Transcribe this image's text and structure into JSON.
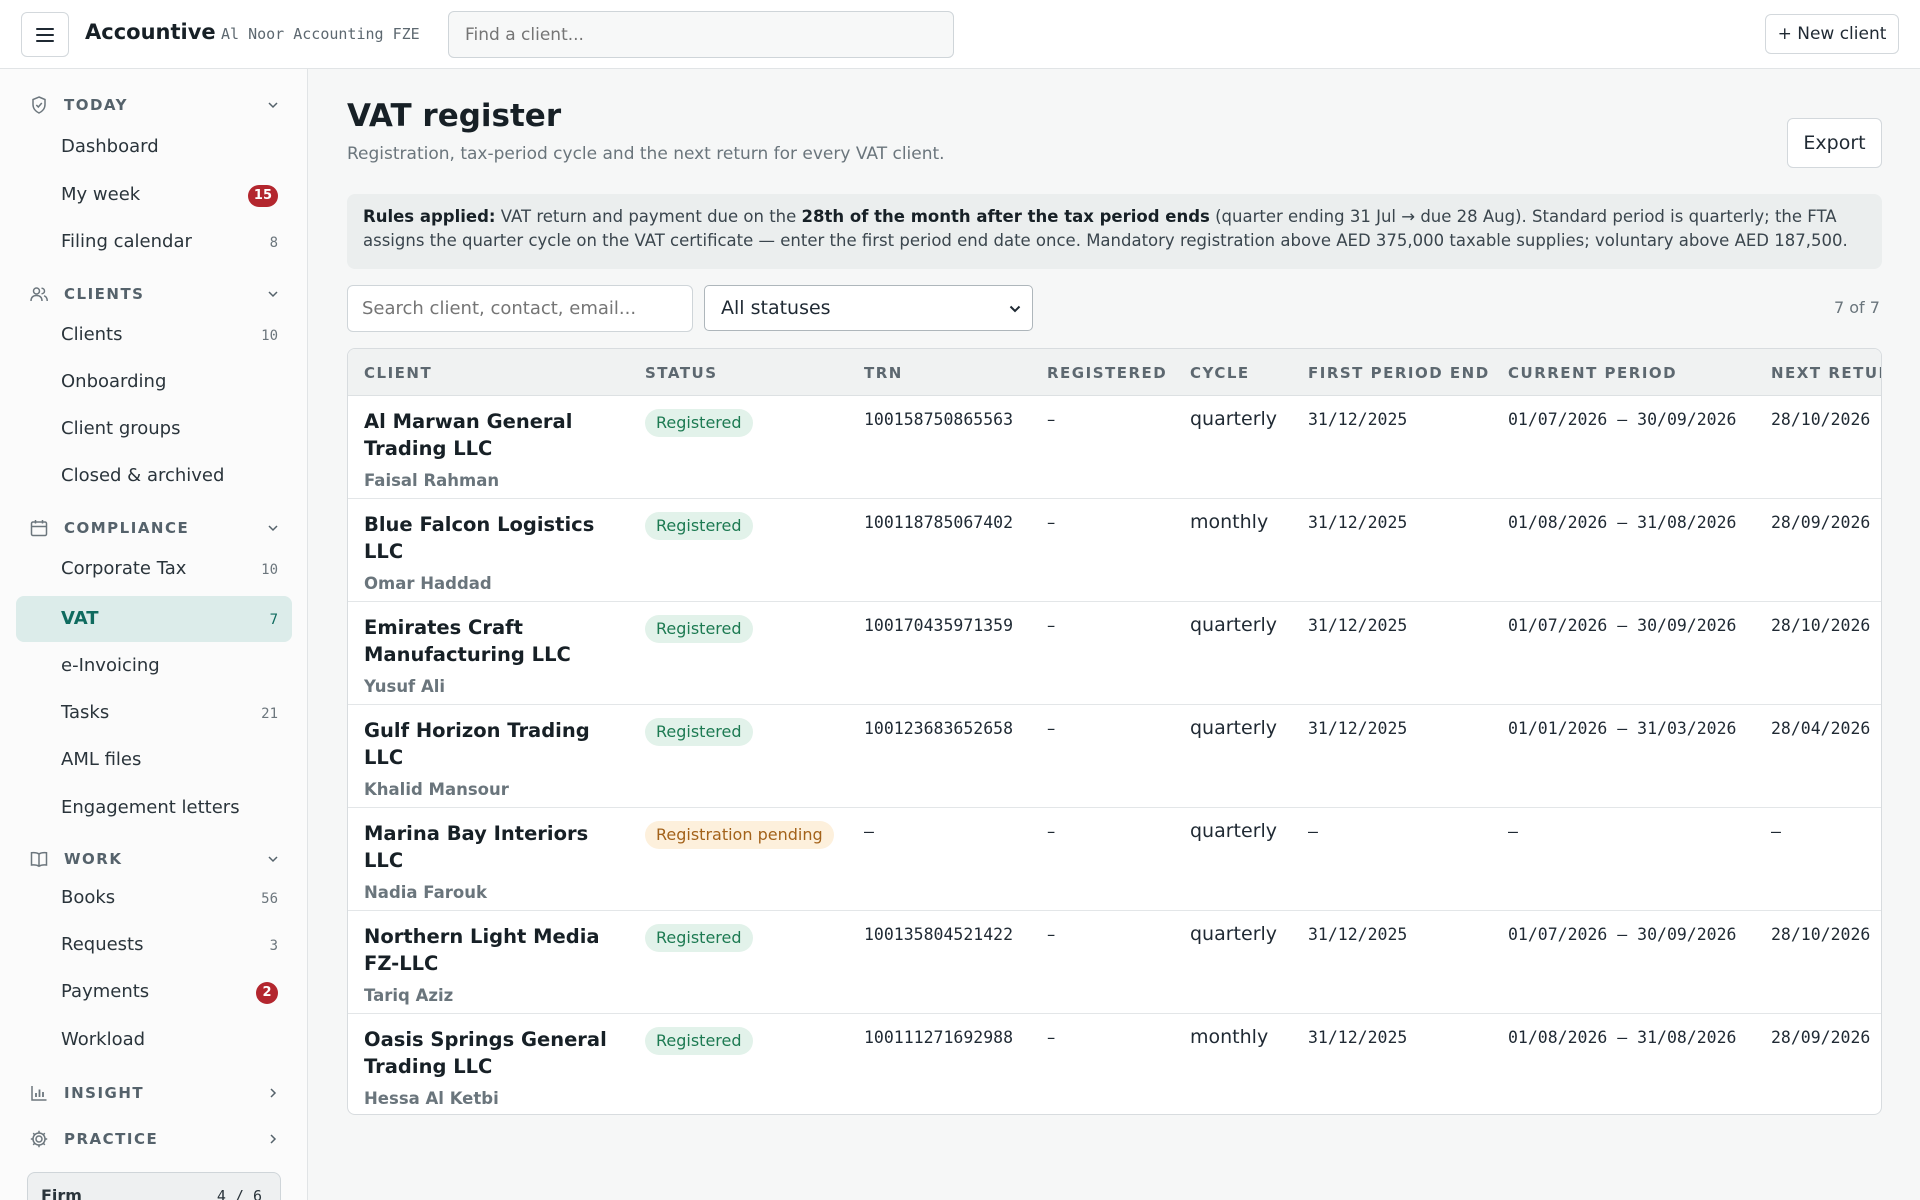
{
  "topbar": {
    "brand": "Accountive",
    "firm": "Al Noor Accounting FZE",
    "search_placeholder": "Find a client...",
    "new_client_label": "+ New client"
  },
  "sidebar": {
    "sections": {
      "today": "TODAY",
      "clients": "CLIENTS",
      "compliance": "COMPLIANCE",
      "work": "WORK",
      "insight": "INSIGHT",
      "practice": "PRACTICE"
    },
    "items": {
      "dashboard": {
        "label": "Dashboard"
      },
      "my_week": {
        "label": "My week",
        "badge": "15"
      },
      "filing_calendar": {
        "label": "Filing calendar",
        "count": "8"
      },
      "clients": {
        "label": "Clients",
        "count": "10"
      },
      "onboarding": {
        "label": "Onboarding"
      },
      "client_groups": {
        "label": "Client groups"
      },
      "closed_archived": {
        "label": "Closed & archived"
      },
      "corporate_tax": {
        "label": "Corporate Tax",
        "count": "10"
      },
      "vat": {
        "label": "VAT",
        "count": "7"
      },
      "e_invoicing": {
        "label": "e-Invoicing"
      },
      "tasks": {
        "label": "Tasks",
        "count": "21"
      },
      "aml_files": {
        "label": "AML files"
      },
      "engagement_letters": {
        "label": "Engagement letters"
      },
      "books": {
        "label": "Books",
        "count": "56"
      },
      "requests": {
        "label": "Requests",
        "count": "3"
      },
      "payments": {
        "label": "Payments",
        "badge": "2"
      },
      "workload": {
        "label": "Workload"
      }
    },
    "firm_card": {
      "label": "Firm",
      "value": "4 / 6"
    }
  },
  "main": {
    "title": "VAT register",
    "subtitle": "Registration, tax-period cycle and the next return for every VAT client.",
    "export_label": "Export",
    "rules": {
      "lead": "Rules applied:",
      "part1": " VAT return and payment due on the ",
      "emph": "28th of the month after the tax period ends",
      "part2": " (quarter ending 31 Jul → due 28 Aug). Standard period is quarterly; the FTA assigns the quarter cycle on the VAT certificate — enter the first period end date once. Mandatory registration above AED 375,000 taxable supplies; voluntary above AED 187,500."
    },
    "filter": {
      "search_placeholder": "Search client, contact, email...",
      "status_selected": "All statuses",
      "count_label": "7 of 7"
    },
    "table": {
      "columns": {
        "client": "CLIENT",
        "status": "STATUS",
        "trn": "TRN",
        "registered": "REGISTERED",
        "cycle": "CYCLE",
        "first_period_end": "FIRST PERIOD END",
        "current_period": "CURRENT PERIOD",
        "next_return": "NEXT RETUR"
      },
      "rows": [
        {
          "name": "Al Marwan General Trading LLC",
          "contact": "Faisal Rahman",
          "status": "Registered",
          "trn": "100158750865563",
          "registered": "–",
          "cycle": "quarterly",
          "first_period_end": "31/12/2025",
          "current_period": "01/07/2026 – 30/09/2026",
          "next_return": "28/10/2026"
        },
        {
          "name": "Blue Falcon Logistics LLC",
          "contact": "Omar Haddad",
          "status": "Registered",
          "trn": "100118785067402",
          "registered": "–",
          "cycle": "monthly",
          "first_period_end": "31/12/2025",
          "current_period": "01/08/2026 – 31/08/2026",
          "next_return": "28/09/2026"
        },
        {
          "name": "Emirates Craft Manufacturing LLC",
          "contact": "Yusuf Ali",
          "status": "Registered",
          "trn": "100170435971359",
          "registered": "–",
          "cycle": "quarterly",
          "first_period_end": "31/12/2025",
          "current_period": "01/07/2026 – 30/09/2026",
          "next_return": "28/10/2026"
        },
        {
          "name": "Gulf Horizon Trading LLC",
          "contact": "Khalid Mansour",
          "status": "Registered",
          "trn": "100123683652658",
          "registered": "–",
          "cycle": "quarterly",
          "first_period_end": "31/12/2025",
          "current_period": "01/01/2026 – 31/03/2026",
          "next_return": "28/04/2026"
        },
        {
          "name": "Marina Bay Interiors LLC",
          "contact": "Nadia Farouk",
          "status": "Registration pending",
          "trn": "–",
          "registered": "–",
          "cycle": "quarterly",
          "first_period_end": "–",
          "current_period": "–",
          "next_return": "–"
        },
        {
          "name": "Northern Light Media FZ-LLC",
          "contact": "Tariq Aziz",
          "status": "Registered",
          "trn": "100135804521422",
          "registered": "–",
          "cycle": "quarterly",
          "first_period_end": "31/12/2025",
          "current_period": "01/07/2026 – 30/09/2026",
          "next_return": "28/10/2026"
        },
        {
          "name": "Oasis Springs General Trading LLC",
          "contact": "Hessa Al Ketbi",
          "status": "Registered",
          "trn": "100111271692988",
          "registered": "–",
          "cycle": "monthly",
          "first_period_end": "31/12/2025",
          "current_period": "01/08/2026 – 31/08/2026",
          "next_return": "28/09/2026"
        }
      ]
    }
  },
  "colors": {
    "accent": "#0f6b5f",
    "active_bg": "#dcecea",
    "badge_red": "#b3262e",
    "status_registered": "#1d7a52",
    "status_pending": "#a3621a"
  }
}
